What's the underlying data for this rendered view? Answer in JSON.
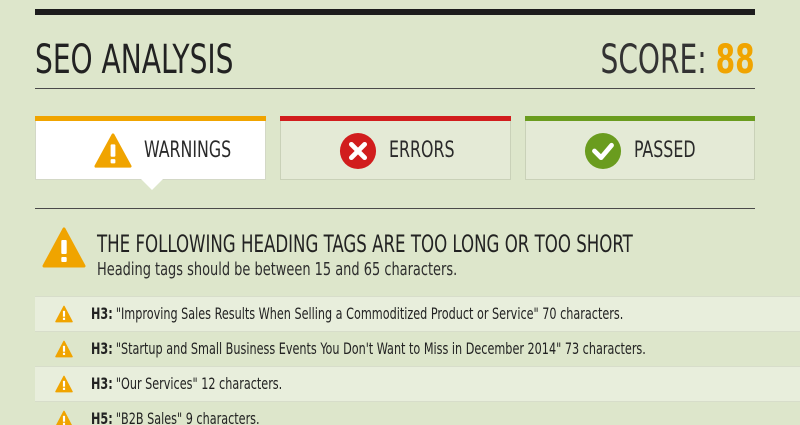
{
  "header": {
    "title": "SEO ANALYSIS",
    "score_label": "SCORE:",
    "score_value": "88"
  },
  "tabs": [
    {
      "label": "WARNINGS",
      "icon": "warning-icon",
      "color": "#f0a400",
      "active": true
    },
    {
      "label": "ERRORS",
      "icon": "error-icon",
      "color": "#d11d1d",
      "active": false
    },
    {
      "label": "PASSED",
      "icon": "check-icon",
      "color": "#6a9c1e",
      "active": false
    }
  ],
  "section": {
    "title": "THE FOLLOWING HEADING TAGS ARE TOO LONG OR TOO SHORT",
    "subtitle": "Heading tags should be between 15 and 65 characters."
  },
  "items": [
    {
      "tag": "H3:",
      "text": "\"Improving Sales Results When Selling a Commoditized Product or Service\" 70 characters."
    },
    {
      "tag": "H3:",
      "text": "\"Startup and Small Business Events You Don't Want to Miss in December 2014\" 73 characters."
    },
    {
      "tag": "H3:",
      "text": "\"Our Services\" 12 characters."
    },
    {
      "tag": "H5:",
      "text": "\"B2B Sales\" 9 characters."
    }
  ],
  "colors": {
    "background": "#dde6cb",
    "accent_warning": "#f0a400",
    "accent_error": "#d11d1d",
    "accent_passed": "#6a9c1e"
  }
}
